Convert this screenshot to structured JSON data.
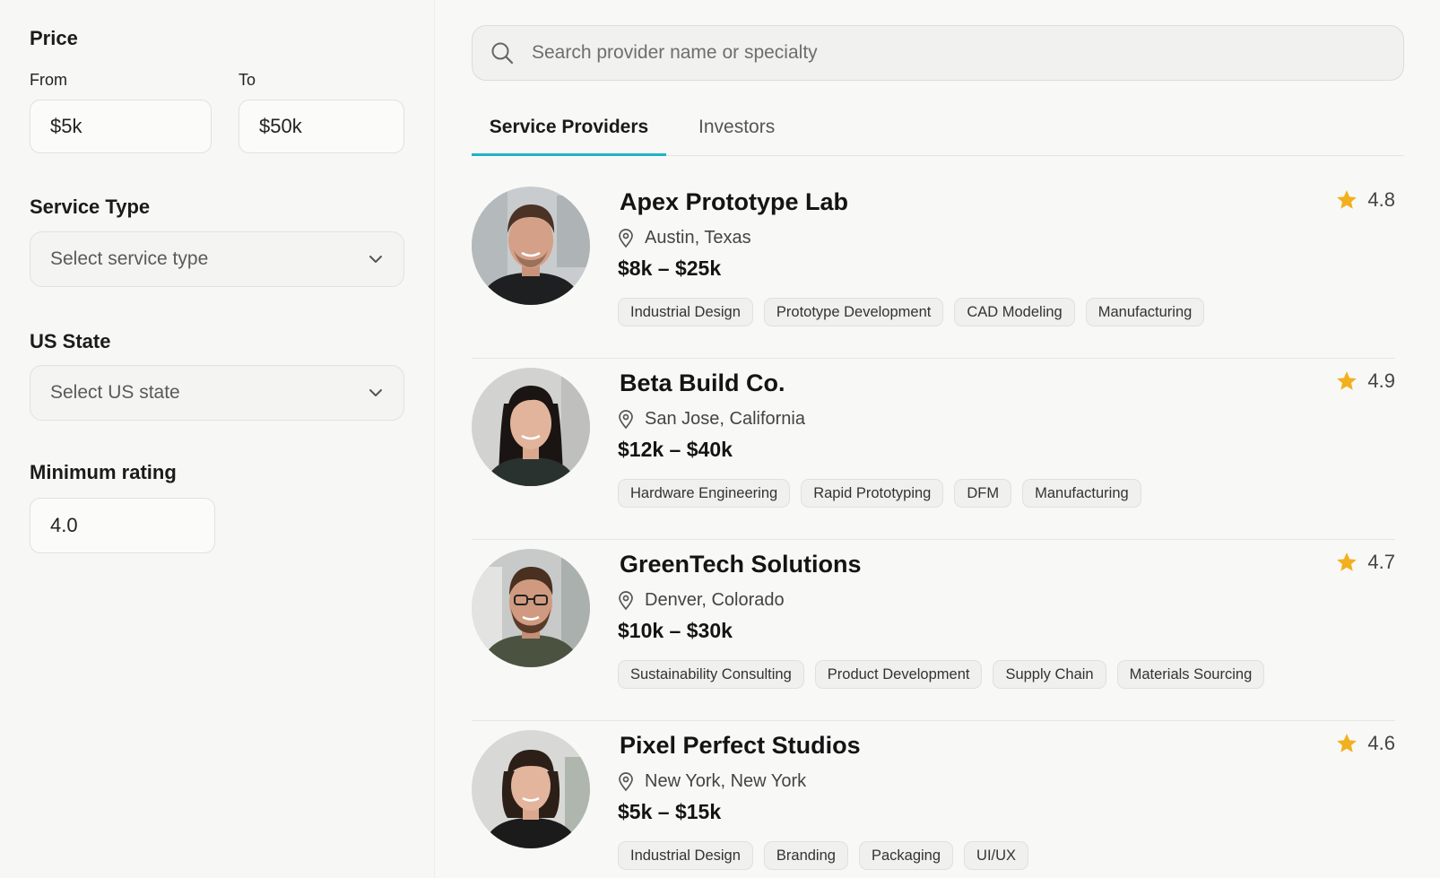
{
  "filters": {
    "price": {
      "title": "Price",
      "from_label": "From",
      "to_label": "To",
      "from_value": "$5k",
      "to_value": "$50k"
    },
    "service_type": {
      "title": "Service Type",
      "placeholder": "Select service type"
    },
    "us_state": {
      "title": "US State",
      "placeholder": "Select US state"
    },
    "min_rating": {
      "title": "Minimum rating",
      "value": "4.0"
    }
  },
  "search": {
    "placeholder": "Search provider name or specialty"
  },
  "tabs": [
    {
      "label": "Service Providers",
      "active": true
    },
    {
      "label": "Investors",
      "active": false
    }
  ],
  "providers": [
    {
      "name": "Apex Prototype Lab",
      "location": "Austin, Texas",
      "price": "$8k – $25k",
      "rating": "4.8",
      "tags": [
        "Industrial Design",
        "Prototype Development",
        "CAD Modeling",
        "Manufacturing"
      ]
    },
    {
      "name": "Beta Build Co.",
      "location": "San Jose, California",
      "price": "$12k – $40k",
      "rating": "4.9",
      "tags": [
        "Hardware Engineering",
        "Rapid Prototyping",
        "DFM",
        "Manufacturing"
      ]
    },
    {
      "name": "GreenTech Solutions",
      "location": "Denver, Colorado",
      "price": "$10k – $30k",
      "rating": "4.7",
      "tags": [
        "Sustainability Consulting",
        "Product Development",
        "Supply Chain",
        "Materials Sourcing"
      ]
    },
    {
      "name": "Pixel Perfect Studios",
      "location": "New York, New York",
      "price": "$5k – $15k",
      "rating": "4.6",
      "tags": [
        "Industrial Design",
        "Branding",
        "Packaging",
        "UI/UX"
      ]
    }
  ],
  "colors": {
    "accent": "#1fb3c7",
    "star": "#f2b01e"
  },
  "icons": {
    "search": "search-icon",
    "pin": "location-pin-icon",
    "star": "star-icon",
    "chevron": "chevron-down-icon"
  }
}
